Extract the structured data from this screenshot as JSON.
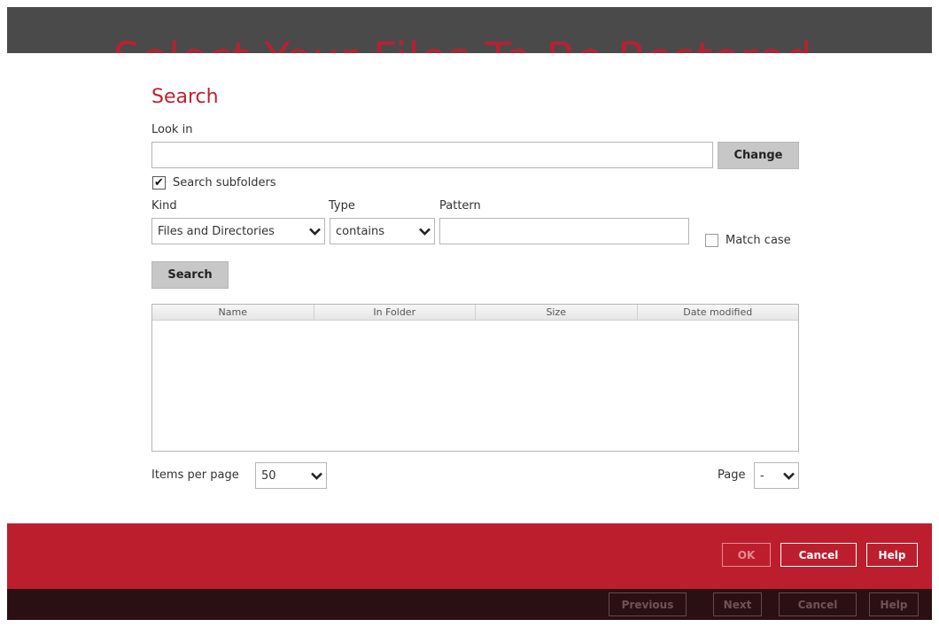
{
  "background": {
    "title": "Select Your Files To Be Restored",
    "buttons": {
      "previous": "Previous",
      "next": "Next",
      "cancel": "Cancel",
      "help": "Help"
    }
  },
  "dialog": {
    "title": "Search",
    "look_in": {
      "label": "Look in",
      "value": "",
      "change_label": "Change"
    },
    "search_subfolders": {
      "label": "Search subfolders",
      "checked": true
    },
    "kind": {
      "label": "Kind",
      "value": "Files and Directories"
    },
    "type": {
      "label": "Type",
      "value": "contains"
    },
    "pattern": {
      "label": "Pattern",
      "value": ""
    },
    "match_case": {
      "label": "Match case",
      "checked": false
    },
    "search_button": "Search",
    "results_table": {
      "columns": [
        "Name",
        "In Folder",
        "Size",
        "Date modified"
      ],
      "rows": []
    },
    "items_per_page": {
      "label": "Items per page",
      "value": "50"
    },
    "page": {
      "label": "Page",
      "value": "-"
    },
    "buttons": {
      "ok": "OK",
      "cancel": "Cancel",
      "help": "Help"
    }
  },
  "colors": {
    "brand_red": "#bd1e2d",
    "title_red": "#c0212f",
    "background_dark": "#2a0f13"
  }
}
